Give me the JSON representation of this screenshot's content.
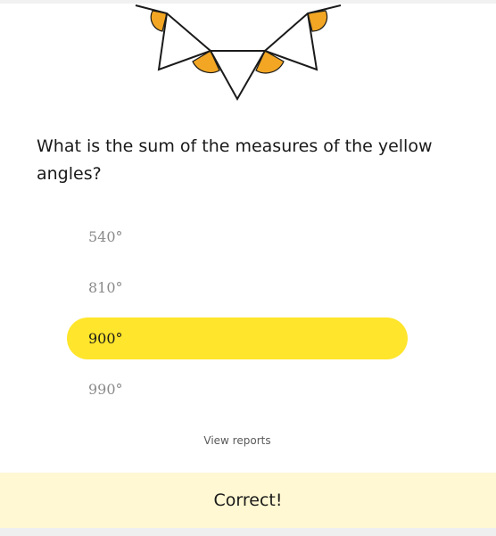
{
  "question": {
    "text": "What is the sum of the measures of the yellow angles?"
  },
  "options": [
    {
      "label": "540°",
      "selected": false
    },
    {
      "label": "810°",
      "selected": false
    },
    {
      "label": "900°",
      "selected": true
    },
    {
      "label": "990°",
      "selected": false
    }
  ],
  "links": {
    "view_reports": "View reports"
  },
  "feedback": {
    "text": "Correct!"
  },
  "colors": {
    "angle_fill": "#f2a623",
    "selected_option": "#ffe52b",
    "feedback_bg": "#fff8d2"
  }
}
